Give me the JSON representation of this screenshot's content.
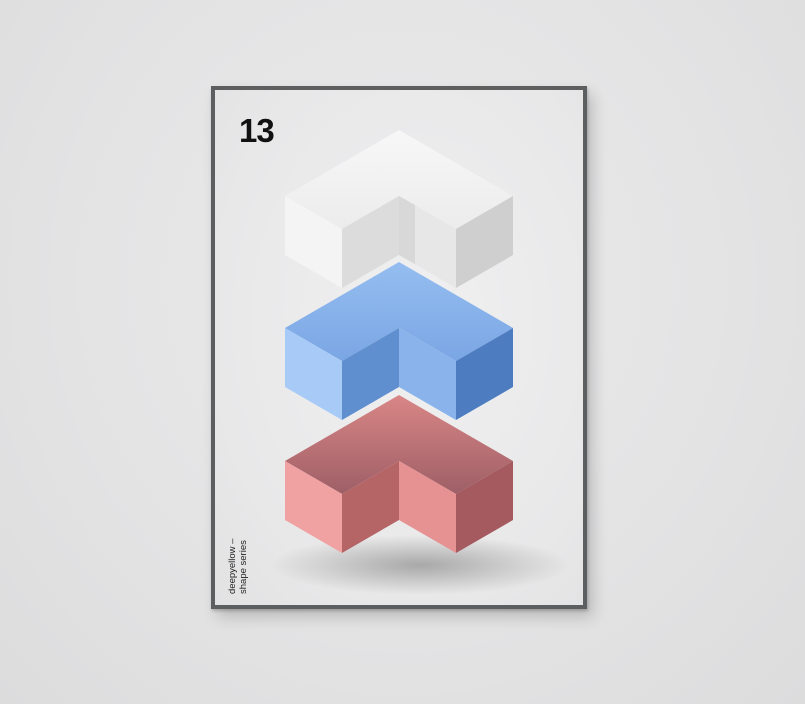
{
  "poster": {
    "number": "13",
    "caption_line1": "deepyellow –",
    "caption_line2": "shape series"
  },
  "colors": {
    "wall": "#e3e3e4",
    "frame": "#5d5e60",
    "paper": "#e9e9ea",
    "white_shape": "#f3f3f3",
    "blue_shape": "#8fb7ec",
    "red_shape": "#e58f90"
  },
  "shapes": [
    "white-chevron-block",
    "blue-chevron-block",
    "red-chevron-block"
  ]
}
